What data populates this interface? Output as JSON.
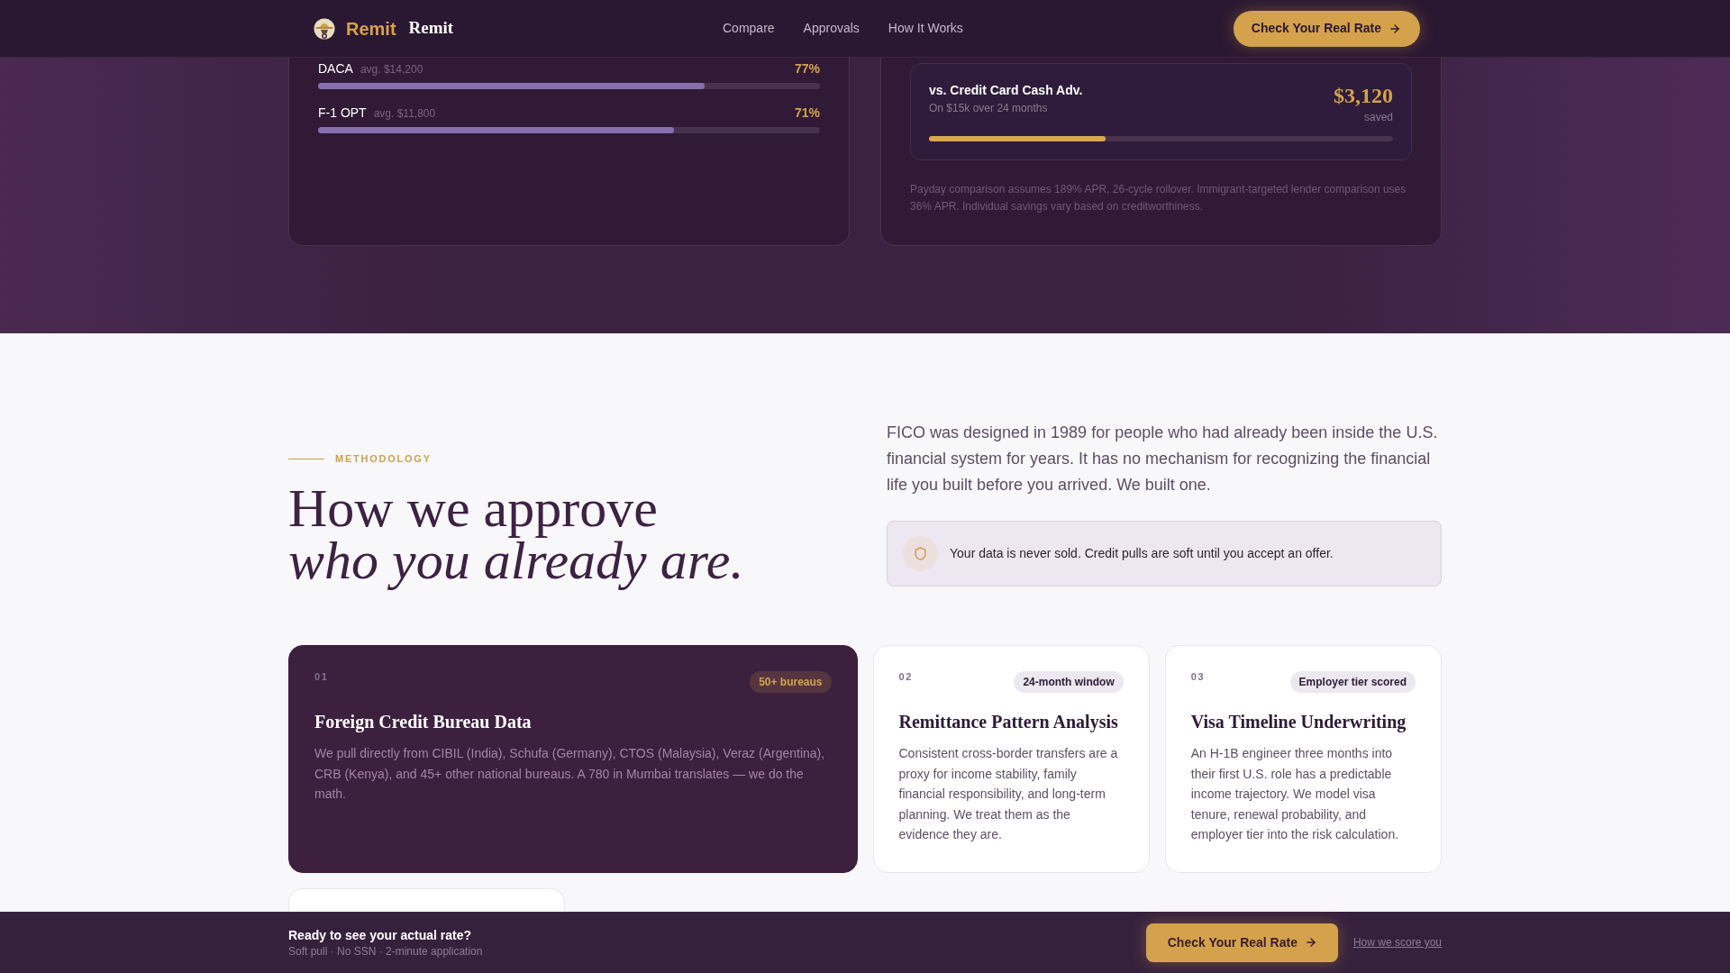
{
  "nav": {
    "brand": {
      "primary": "Remit",
      "secondary": "Remit"
    },
    "links": [
      "Compare",
      "Approvals",
      "How It Works"
    ],
    "cta": "Check Your Real Rate"
  },
  "approval_rates": [
    {
      "status": "DACA",
      "average": "avg. $14,200",
      "rate": "77%",
      "level": 0.77
    },
    {
      "status": "F-1 OPT",
      "average": "avg. $11,800",
      "rate": "71%",
      "level": 0.71
    }
  ],
  "savings": {
    "comparison": {
      "title": "vs. Credit Card Cash Adv.",
      "subtitle": "On $15k over 24 months",
      "amount": "$3,120",
      "amount_note": "saved",
      "level": 0.38
    },
    "footnote": "Payday comparison assumes 189% APR, 26-cycle rollover. Immigrant-targeted lender comparison uses 36% APR. Individual savings vary based on creditworthiness."
  },
  "methodology": {
    "eyebrow": "METHODOLOGY",
    "heading": [
      {
        "text": "How we approve",
        "italic": false
      },
      {
        "text": "who you already are.",
        "italic": true
      }
    ],
    "intro": "FICO was designed in 1989 for people who had already been inside the U.S. financial system for years. It has no mechanism for recognizing the financial life you built before you arrived. We built one.",
    "notice": "Your data is never sold. Credit pulls are soft until you accept an offer."
  },
  "cards": [
    {
      "number": "01",
      "badge": "50+ bureaus",
      "title": "Foreign Credit Bureau Data",
      "body": "We pull directly from CIBIL (India), Schufa (Germany), CTOS (Malaysia), Veraz (Argentina), CRB (Kenya), and 45+ other national bureaus. A 780 in Mumbai translates — we do the math.",
      "featured": true
    },
    {
      "number": "02",
      "badge": "24-month window",
      "title": "Remittance Pattern Analysis",
      "body": "Consistent cross-border transfers are a proxy for income stability, family financial responsibility, and long-term planning. We treat them as the evidence they are.",
      "featured": false
    },
    {
      "number": "03",
      "badge": "Employer tier scored",
      "title": "Visa Timeline Underwriting",
      "body": "An H-1B engineer three months into their first U.S. role has a predictable income trajectory. We model visa tenure, renewal probability, and employer tier into the risk calculation.",
      "featured": false
    },
    {
      "featured": false
    }
  ],
  "cta_bar": {
    "title": "Ready to see your actual rate?",
    "subtitle": "Soft pull · No SSN · 2-minute application",
    "button": "Check Your Real Rate",
    "link": "How we score you"
  }
}
